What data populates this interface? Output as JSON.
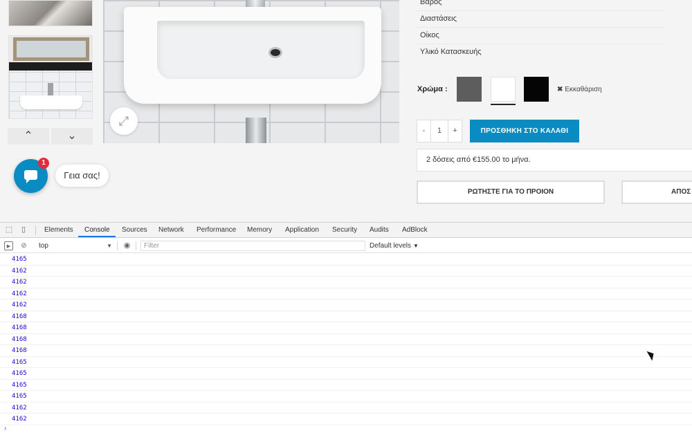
{
  "product": {
    "attributes": [
      "Βάρος",
      "Διαστάσεις",
      "Οίκος",
      "Υλικό Κατασκευής"
    ],
    "color_label": "Χρώμα :",
    "swatches": [
      "#5d5d5d",
      "#ffffff",
      "#050505"
    ],
    "selected_swatch": "#ffffff",
    "clear_label": "Εκκαθάριση",
    "qty_minus": "-",
    "qty_value": "1",
    "qty_plus": "+",
    "add_to_cart": "ΠΡΟΣΘΗΚΗ ΣΤΟ ΚΑΛΑΘΙ",
    "installments": "2 δόσεις από €155.00 το μήνα.",
    "ask_button": "ΡΩΤΗΣΤΕ ΓΙΑ ΤΟ ΠΡΟΙΟΝ",
    "apos_button": "ΑΠΟΣ",
    "accent": "#0a8bc1"
  },
  "gallery": {
    "up": "⌃",
    "down": "⌄",
    "zoom": "⤢"
  },
  "chat": {
    "badge": "1",
    "greeting": "Γεια σας!"
  },
  "devtools": {
    "tabs": [
      "Elements",
      "Console",
      "Sources",
      "Network",
      "Performance",
      "Memory",
      "Application",
      "Security",
      "Audits",
      "AdBlock"
    ],
    "active_tab": "Console",
    "context": "top",
    "filter_placeholder": "Filter",
    "levels": "Default levels",
    "log": [
      "4165",
      "4162",
      "4162",
      "4162",
      "4162",
      "4168",
      "4168",
      "4168",
      "4168",
      "4165",
      "4165",
      "4165",
      "4165",
      "4162",
      "4162"
    ],
    "prompt": "›"
  }
}
